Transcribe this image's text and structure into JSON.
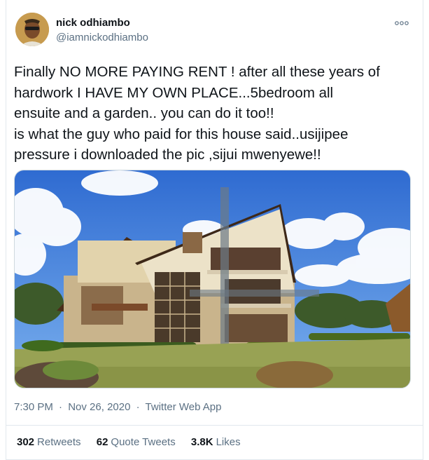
{
  "tweet": {
    "author": {
      "name": "nick odhiambo",
      "handle": "@iamnickodhiambo"
    },
    "text": "Finally NO MORE PAYING RENT ! after all these years of\nhardwork I HAVE MY OWN PLACE...5bedroom all\nensuite and a garden.. you can do it too!!\nis what the guy who paid for this house said..usijipee\npressure i downloaded the pic ,sijui mwenyewe!!",
    "more_icon": "more-horizontal-icon",
    "meta": {
      "time": "7:30 PM",
      "date": "Nov 26, 2020",
      "app": "Twitter Web App",
      "sep": "·"
    },
    "stats": {
      "retweets": {
        "count": "302",
        "label": "Retweets"
      },
      "quotes": {
        "count": "62",
        "label": "Quote Tweets"
      },
      "likes": {
        "count": "3.8K",
        "label": "Likes"
      }
    }
  },
  "colors": {
    "text": "#0f1419",
    "secondary": "#5b7083",
    "border": "#e1e8ed"
  }
}
